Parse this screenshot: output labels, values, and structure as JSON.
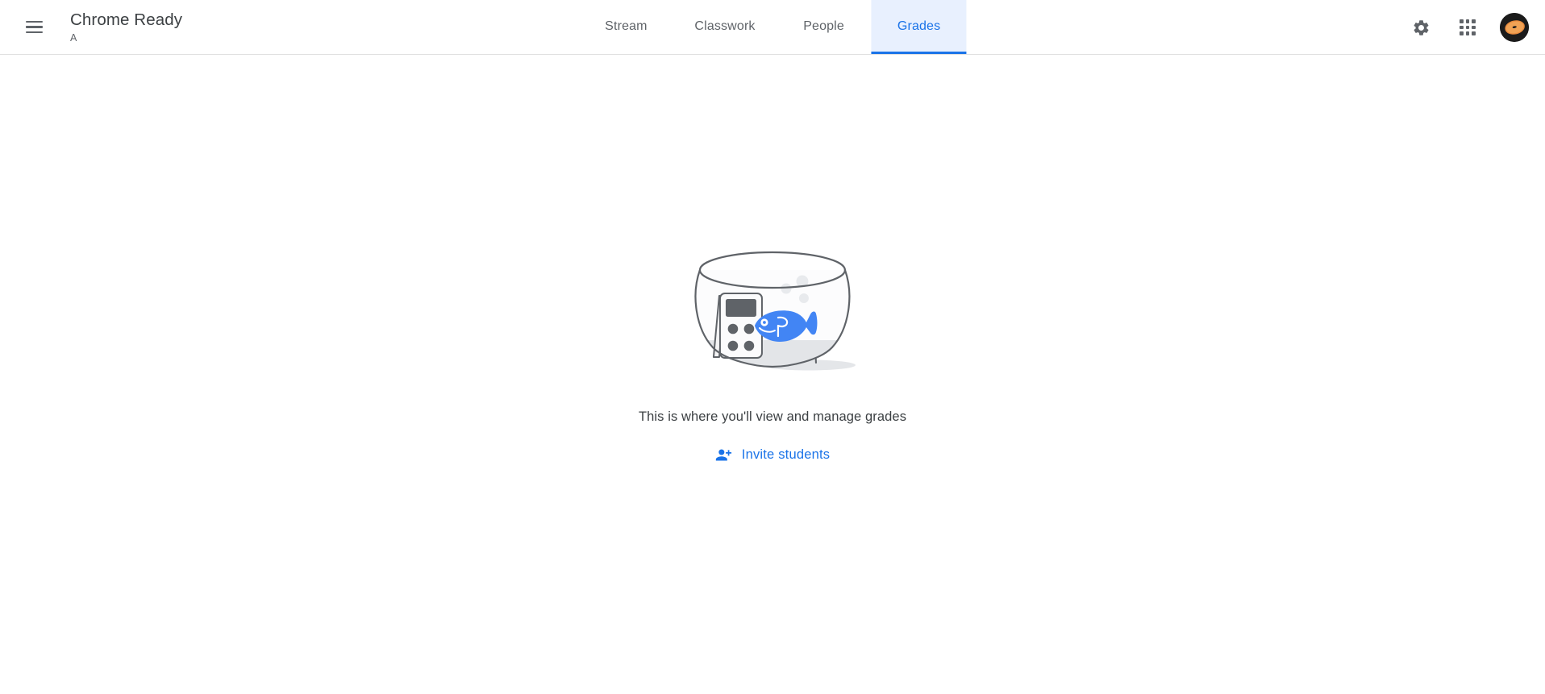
{
  "header": {
    "menu_icon": "hamburger-menu-icon",
    "course_name": "Chrome Ready",
    "course_section": "A",
    "tabs": [
      {
        "label": "Stream",
        "active": false
      },
      {
        "label": "Classwork",
        "active": false
      },
      {
        "label": "People",
        "active": false
      },
      {
        "label": "Grades",
        "active": true
      }
    ],
    "actions": {
      "settings_icon": "gear-icon",
      "apps_icon": "apps-grid-icon",
      "avatar_icon": "user-avatar"
    }
  },
  "main": {
    "illustration": "fishbowl-with-calculator-and-fish-illustration",
    "empty_title": "This is where you'll view and manage grades",
    "invite_button_label": "Invite students",
    "invite_button_icon": "person-add-icon"
  },
  "colors": {
    "accent_blue": "#1a73e8",
    "tab_active_bg": "#e8f0fe",
    "text_primary": "#3c4043",
    "text_secondary": "#5f6368",
    "fish_blue": "#4285f4",
    "avatar_orange": "#e8893c",
    "page_background": "#ffffff",
    "header_border": "#e0e0e0"
  }
}
